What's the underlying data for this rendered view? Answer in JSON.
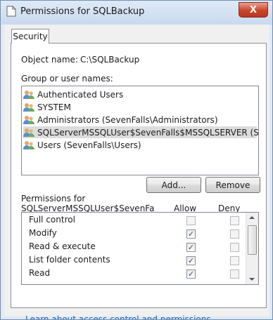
{
  "window": {
    "title": "Permissions for SQLBackup",
    "close_glyph": "X"
  },
  "tab": {
    "label": "Security"
  },
  "object": {
    "label": "Object name:",
    "value": "C:\\SQLBackup"
  },
  "groups": {
    "label": "Group or user names:",
    "items": [
      {
        "label": "Authenticated Users"
      },
      {
        "label": "SYSTEM"
      },
      {
        "label": "Administrators (SevenFalls\\Administrators)"
      },
      {
        "label": "SQLServerMSSQLUser$SevenFalls$MSSQLSERVER (SEV..."
      },
      {
        "label": "Users (SevenFalls\\Users)"
      }
    ],
    "selected_index": 3
  },
  "buttons": {
    "add": "Add...",
    "remove": "Remove"
  },
  "permissions": {
    "label_line1": "Permissions for",
    "label_line2": "SQLServerMSSQLUser$SevenFa",
    "allow_header": "Allow",
    "deny_header": "Deny",
    "rows": [
      {
        "name": "Full control",
        "allow": false,
        "deny": false
      },
      {
        "name": "Modify",
        "allow": true,
        "deny": false
      },
      {
        "name": "Read & execute",
        "allow": true,
        "deny": false
      },
      {
        "name": "List folder contents",
        "allow": true,
        "deny": false
      },
      {
        "name": "Read",
        "allow": true,
        "deny": false
      }
    ]
  },
  "link": {
    "text": "Learn about access control and permissions"
  },
  "colors": {
    "link": "#1c5fad",
    "titlebar": "#c9d9ee",
    "selection": "#dcdcdc"
  }
}
